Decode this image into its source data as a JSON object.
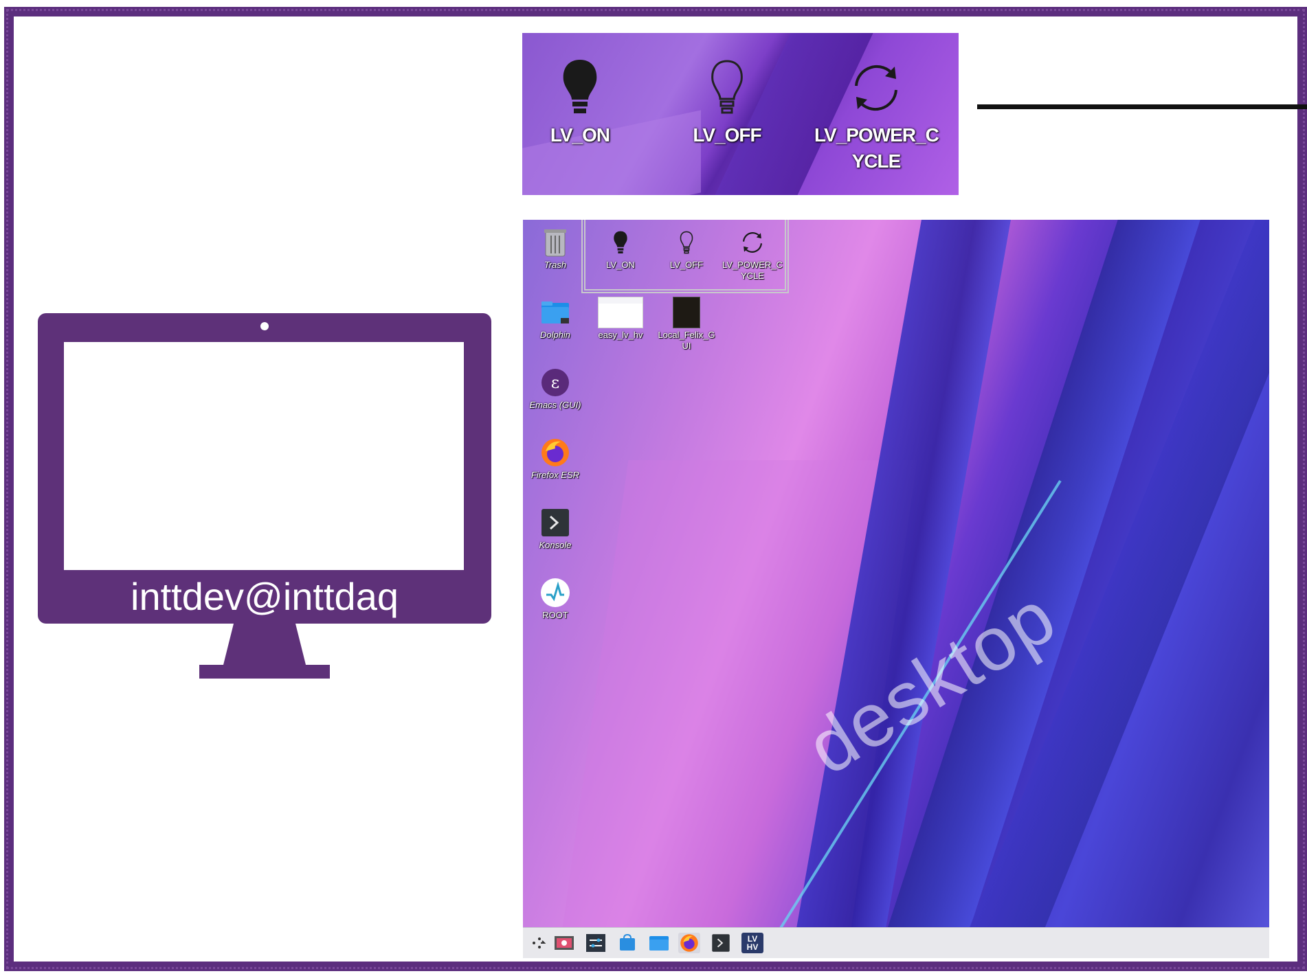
{
  "zoom_panel": {
    "icons": [
      {
        "label": "LV_ON"
      },
      {
        "label": "LV_OFF"
      },
      {
        "label": "LV_POWER_C\nYCLE",
        "line1": "LV_POWER_C",
        "line2": "YCLE"
      }
    ]
  },
  "monitor": {
    "label": "inttdev@inttdaq"
  },
  "desktop": {
    "watermark": "desktop",
    "icons": {
      "trash": "Trash",
      "lv_on": "LV_ON",
      "lv_off": "LV_OFF",
      "lv_power_cycle_1": "LV_POWER_C",
      "lv_power_cycle_2": "YCLE",
      "dolphin": "Dolphin",
      "easy_lv_hv": "easy_lv_hv",
      "local_felix_1": "Local_Felix_G",
      "local_felix_2": "UI",
      "emacs": "Emacs (GUI)",
      "firefox": "Firefox ESR",
      "konsole": "Konsole",
      "root": "ROOT"
    },
    "taskbar": {
      "lvhv_line1": "LV",
      "lvhv_line2": "HV"
    }
  },
  "colors": {
    "frame": "#5c2e7e",
    "monitor": "#5e3179"
  }
}
